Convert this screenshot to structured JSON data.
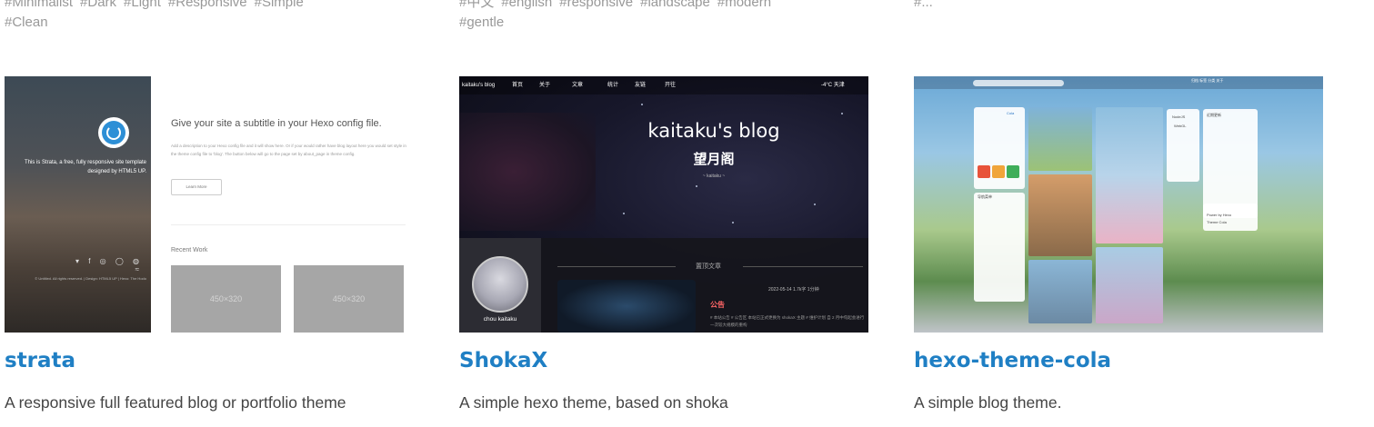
{
  "themes": [
    {
      "tags": [
        "#Minimalist",
        "#Dark",
        "#Light",
        "#Responsive",
        "#Simple",
        "#Clean"
      ],
      "name": "strata",
      "description": "A responsive full featured blog or portfolio theme",
      "preview": {
        "intro": "This is Strata, a free, fully responsive site template designed by HTML5 UP.",
        "footer": "© Untitled. All rights reserved. | Design: HTML5 UP | Hexo: The Hodo",
        "heading": "Give your site a subtitle in your Hexo config file.",
        "paragraph": "Add a description to your Hexo config file and it will show here. Or if your would rather have blog layout here you would set style in the theme config file to 'blog'. The button below will go to the page set by about_page in theme config.",
        "button": "Learn More",
        "recent": "Recent Work",
        "placeholder_1": "450×320",
        "placeholder_2": "450×320",
        "social_icons": "▾ f ◎ ◯ ◍ ≈"
      }
    },
    {
      "tags": [
        "#中文",
        "#english",
        "#responsive",
        "#landscape",
        "#modern",
        "#gentle"
      ],
      "name": "ShokaX",
      "description": "A simple hexo theme, based on shoka",
      "preview": {
        "nav_brand": "kaitaku's blog",
        "nav_items": [
          "首页",
          "关于",
          "文章",
          "统计",
          "友链",
          "开往"
        ],
        "nav_weather": "-4°C 天津",
        "brand": "kaitaku's blog",
        "subtitle": "望月阁",
        "small": "~ kaitaku ~",
        "author": "chou kaitaku",
        "pinned": "置顶文章",
        "meta": "2022-05-14  1.7k字  1分钟",
        "notice": "公告",
        "excerpt": "# 本站公告 # 公告区 本站已正式更换为 shokaX 主题 # 维护计划 自 2 月中旬起会进行一次较大规模的重构"
      }
    },
    {
      "tags": [
        "#..."
      ],
      "name": "hexo-theme-cola",
      "description": "A simple blog theme.",
      "preview": {
        "nav_links": "归档   标签   分类   关于",
        "profile_name": "Cola",
        "label_node": "NodeJS",
        "label_web": "WebGL",
        "label_title": "近期更新",
        "label_sidebar": "导航菜单",
        "label_power": "Power by Hexo",
        "label_theme": "Theme Cola"
      }
    }
  ]
}
